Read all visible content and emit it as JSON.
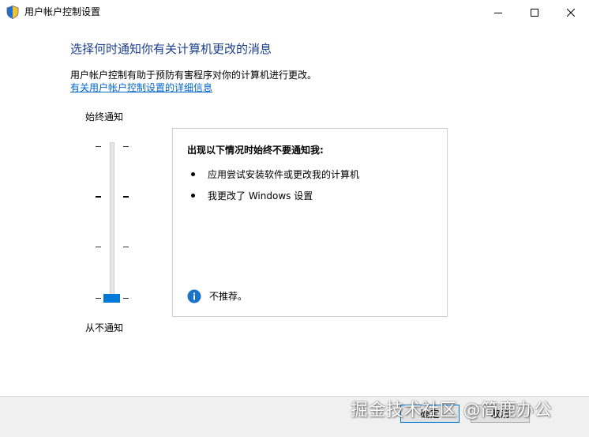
{
  "window": {
    "title": "用户帐户控制设置",
    "icon": "uac-shield-icon"
  },
  "main": {
    "heading": "选择何时通知你有关计算机更改的消息",
    "description": "用户帐户控制有助于预防有害程序对你的计算机进行更改。",
    "link": "有关用户帐户控制设置的详细信息"
  },
  "slider": {
    "top_label": "始终通知",
    "bottom_label": "从不通知",
    "levels": 4,
    "selected_level": 1
  },
  "panel": {
    "title": "出现以下情况时始终不要通知我:",
    "items": [
      "应用尝试安装软件或更改我的计算机",
      "我更改了 Windows 设置"
    ],
    "note": "不推荐。"
  },
  "footer": {
    "ok_label": "确定",
    "cancel_label": "取消"
  },
  "watermark": "掘金技术社区 @简鹿办公",
  "colors": {
    "accent": "#0078d7",
    "heading": "#1c3f8f",
    "link": "#0066cc"
  }
}
